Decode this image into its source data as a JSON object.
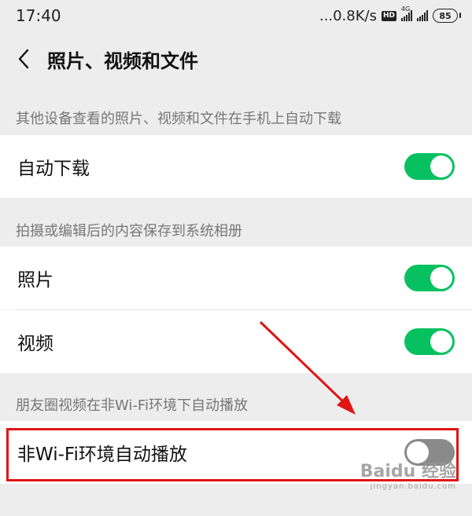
{
  "status_bar": {
    "time": "17:40",
    "net_speed": "...0.8K/s",
    "hd": "HD",
    "network": "4G",
    "battery": "85"
  },
  "header": {
    "back_icon": "chevron-left-icon",
    "title": "照片、视频和文件"
  },
  "sections": [
    {
      "header": "其他设备查看的照片、视频和文件在手机上自动下载",
      "items": [
        {
          "label": "自动下载",
          "checked": true
        }
      ]
    },
    {
      "header": "拍摄或编辑后的内容保存到系统相册",
      "items": [
        {
          "label": "照片",
          "checked": true
        },
        {
          "label": "视频",
          "checked": true
        }
      ]
    },
    {
      "header": "朋友圈视频在非Wi-Fi环境下自动播放",
      "items": [
        {
          "label": "非Wi-Fi环境自动播放",
          "checked": false
        }
      ]
    }
  ],
  "colors": {
    "toggle_on": "#07c160",
    "toggle_off": "#8a8a8a",
    "annotation": "#e01414",
    "background": "#ededed"
  },
  "watermark": {
    "brand": "Baidu 经验",
    "url": "jingyan.baidu.com"
  }
}
